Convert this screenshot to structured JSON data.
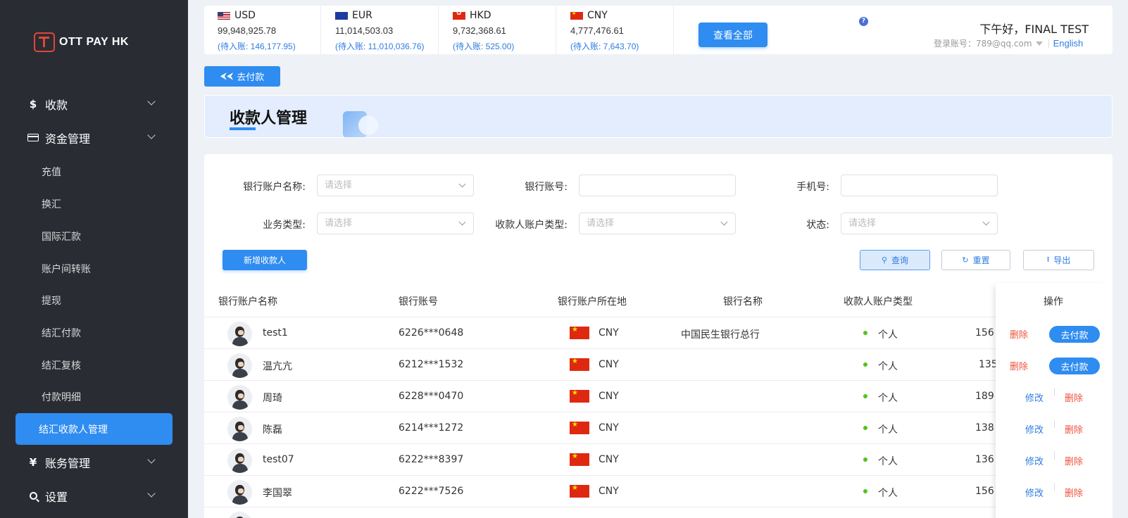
{
  "sidebar": {
    "logo_text": "OTT PAY HK",
    "menu": [
      {
        "icon": "dollar-icon",
        "glyph": "$",
        "label": "收款"
      },
      {
        "icon": "card-icon",
        "glyph": "",
        "label": "资金管理"
      },
      {
        "icon": "yen-icon",
        "glyph": "¥",
        "label": "账务管理"
      },
      {
        "icon": "search-icon",
        "glyph": "",
        "label": "设置"
      }
    ],
    "submenu": [
      "充值",
      "换汇",
      "国际汇款",
      "账户间转账",
      "提现",
      "结汇付款",
      "结汇复核",
      "付款明细",
      "结汇收款人管理"
    ]
  },
  "balances": [
    {
      "code": "USD",
      "amount": "99,948,925.78",
      "pending": "(待入账: 146,177.95)"
    },
    {
      "code": "EUR",
      "amount": "11,014,503.03",
      "pending": "(待入账: 11,010,036.76)"
    },
    {
      "code": "HKD",
      "amount": "9,732,368.61",
      "pending": "(待入账: 525.00)"
    },
    {
      "code": "CNY",
      "amount": "4,777,476.61",
      "pending": "(待入账: 7,643.70)"
    }
  ],
  "header": {
    "view_all": "查看全部",
    "greeting": "下午好，FINAL TEST",
    "login_label": "登录账号：789@qq.com",
    "language": "English"
  },
  "pay_button": "去付款",
  "page_title": "收款人管理",
  "filters": {
    "account_name_label": "银行账户名称:",
    "account_name_placeholder": "请选择",
    "account_no_label": "银行账号:",
    "phone_label": "手机号:",
    "biz_type_label": "业务类型:",
    "biz_type_placeholder": "请选择",
    "payee_type_label": "收款人账户类型:",
    "payee_type_placeholder": "请选择",
    "status_label": "状态:",
    "status_placeholder": "请选择"
  },
  "actions": {
    "add": "新增收款人",
    "query": "查询",
    "reset": "重置",
    "export": "导出"
  },
  "table": {
    "headers": {
      "name": "银行账户名称",
      "account": "银行账号",
      "location": "银行账户所在地",
      "bank": "银行名称",
      "type": "收款人账户类型",
      "ops": "操作"
    },
    "rows": [
      {
        "name": "test1",
        "account": "6226***0648",
        "currency": "CNY",
        "bank": "中国民生银行总行",
        "type": "个人",
        "phone": "156",
        "ops": "pay"
      },
      {
        "name": "温亢亢",
        "account": "6212***1532",
        "currency": "CNY",
        "bank": "",
        "type": "个人",
        "phone": "135",
        "ops": "pay"
      },
      {
        "name": "周琦",
        "account": "6228***0470",
        "currency": "CNY",
        "bank": "",
        "type": "个人",
        "phone": "189",
        "ops": "edit"
      },
      {
        "name": "陈磊",
        "account": "6214***1272",
        "currency": "CNY",
        "bank": "",
        "type": "个人",
        "phone": "138",
        "ops": "edit"
      },
      {
        "name": "test07",
        "account": "6222***8397",
        "currency": "CNY",
        "bank": "",
        "type": "个人",
        "phone": "136",
        "ops": "edit"
      },
      {
        "name": "李国翠",
        "account": "6222***7526",
        "currency": "CNY",
        "bank": "",
        "type": "个人",
        "phone": "156",
        "ops": "edit"
      }
    ],
    "op_labels": {
      "delete": "删除",
      "edit": "修改",
      "pay": "去付款"
    }
  },
  "colors": {
    "primary": "#2f8cf0",
    "sidebar_bg": "#2a2c34",
    "danger": "#f0533f",
    "status_dot": "#52c41a"
  }
}
